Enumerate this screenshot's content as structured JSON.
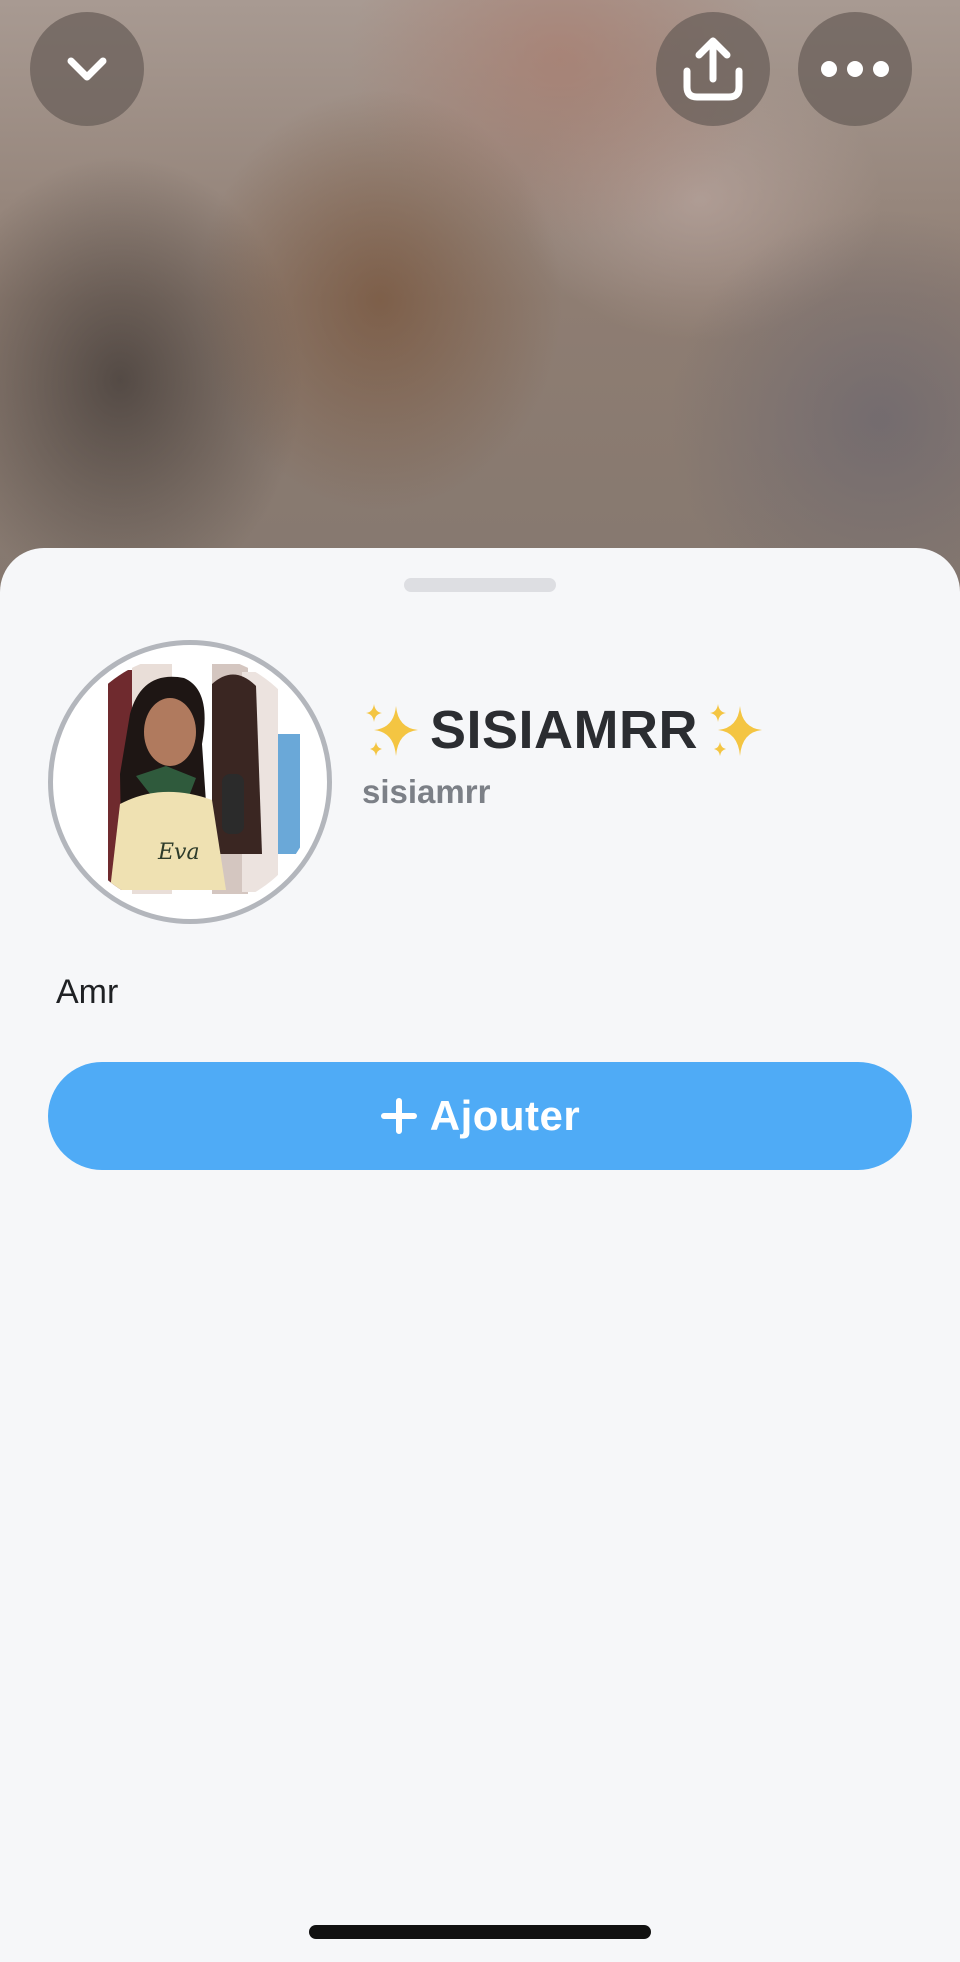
{
  "header": {
    "icons": {
      "collapse": "chevron-down-icon",
      "share": "share-upload-icon",
      "more": "more-horizontal-icon"
    }
  },
  "profile": {
    "display_name": "SISIAMRR",
    "display_name_decoration": "sparkles-icon",
    "username": "sisiamrr",
    "bio": "Amr",
    "avatar_ring_color": "#b3b6bc"
  },
  "actions": {
    "add_label": "Ajouter",
    "add_icon": "plus-icon",
    "add_color": "#4fabf6"
  }
}
